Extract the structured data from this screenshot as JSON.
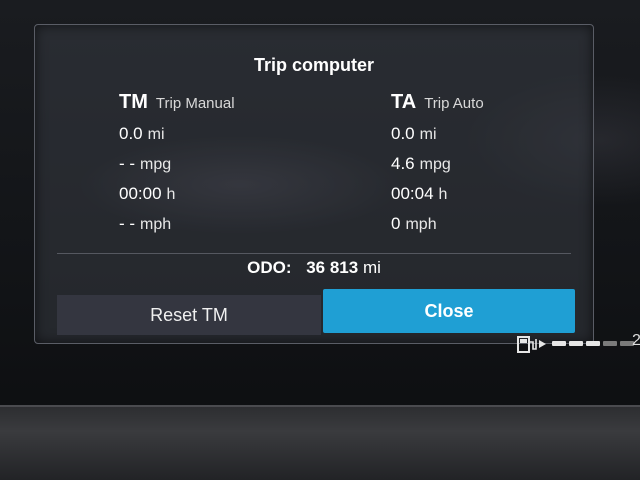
{
  "dialog": {
    "title": "Trip computer",
    "trip_manual": {
      "abbr": "TM",
      "label": "Trip Manual",
      "distance": {
        "value": "0.0",
        "unit": "mi"
      },
      "consumption": {
        "value": "- -",
        "unit": "mpg"
      },
      "time": {
        "value": "00:00",
        "unit": "h"
      },
      "speed": {
        "value": "- -",
        "unit": "mph"
      }
    },
    "trip_auto": {
      "abbr": "TA",
      "label": "Trip Auto",
      "distance": {
        "value": "0.0",
        "unit": "mi"
      },
      "consumption": {
        "value": "4.6",
        "unit": "mpg"
      },
      "time": {
        "value": "00:04",
        "unit": "h"
      },
      "speed": {
        "value": "0",
        "unit": "mph"
      }
    },
    "odometer": {
      "label": "ODO:",
      "value": "36 813",
      "unit": "mi"
    },
    "buttons": {
      "reset": "Reset TM",
      "close": "Close"
    }
  },
  "fuel_gauge": {
    "icon": "fuel-pump-icon",
    "level_fraction": 0.6
  },
  "edge_glyph": "2",
  "colors": {
    "accent": "#1f9fd4",
    "text": "#ffffff",
    "panel": "#343640"
  }
}
